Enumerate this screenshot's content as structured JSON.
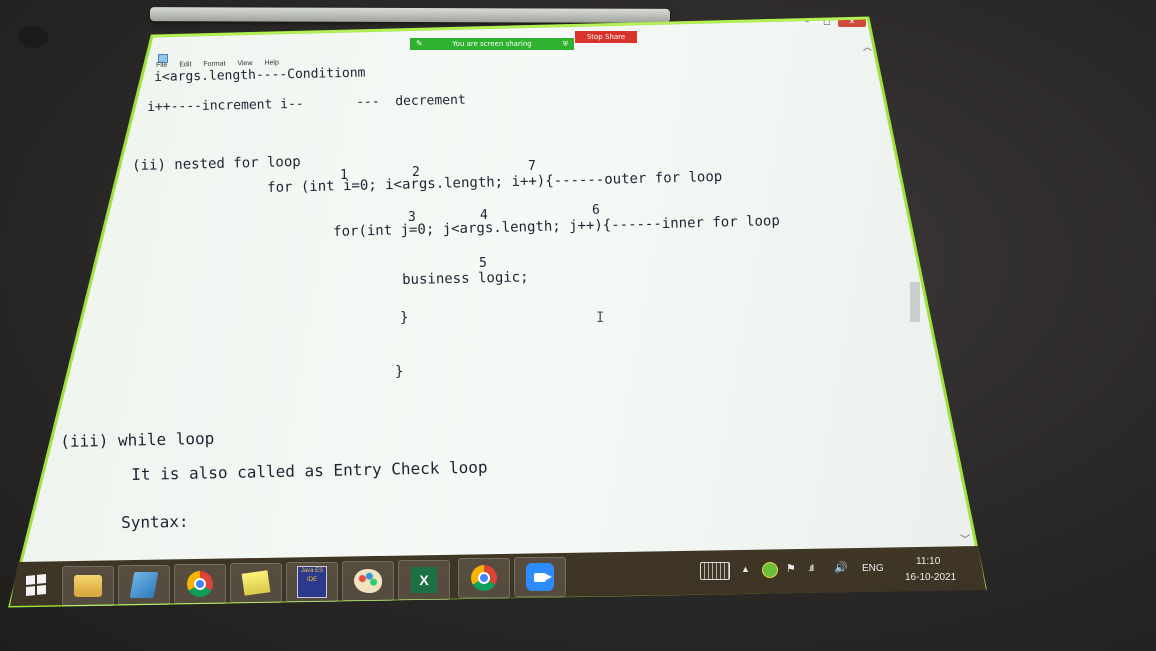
{
  "share": {
    "status": "You are screen sharing",
    "stop_label": "Stop Share"
  },
  "window_controls": {
    "minimize": "–",
    "maximize": "□",
    "close": "✕"
  },
  "menu": [
    "File",
    "Edit",
    "Format",
    "View",
    "Help"
  ],
  "editor": {
    "line1": "i<args.length----Conditionm",
    "line2a": "i++----increment i--",
    "line2b": "---  decrement",
    "heading_nested": "(ii) nested for loop",
    "outer_for": "for (int i=0; i<args.length; i++){------outer for loop",
    "inner_for": "for(int j=0; j<args.length; j++){------inner for loop",
    "business": "business logic;",
    "brace_inner": "}",
    "brace_outer": "}",
    "heading_while": "(iii) while loop",
    "entry_check": "It is also called as Entry Check loop",
    "syntax": "Syntax:",
    "step_numbers": {
      "n1": "1",
      "n2": "2",
      "n7": "7",
      "n3": "3",
      "n4": "4",
      "n6": "6",
      "n5": "5"
    },
    "cursor": "I"
  },
  "taskbar": {
    "apps": [
      "file-explorer-icon",
      "book-icon",
      "chrome-icon",
      "sticky-notes-icon",
      "java-ide-icon",
      "paint-icon",
      "excel-icon",
      "chrome-icon",
      "zoom-icon"
    ],
    "java_label": "Java ES IDE",
    "excel_label": "X",
    "tray": {
      "arrow": "▲",
      "flag": "⚑",
      "signal": ".ıll",
      "volume": "🔊",
      "language": "ENG",
      "time": "11:10",
      "date": "16-10-2021"
    }
  },
  "colors": {
    "screen_border": "#9ee33a",
    "share_bar": "#2fb02f",
    "stop_share": "#d9332a"
  }
}
